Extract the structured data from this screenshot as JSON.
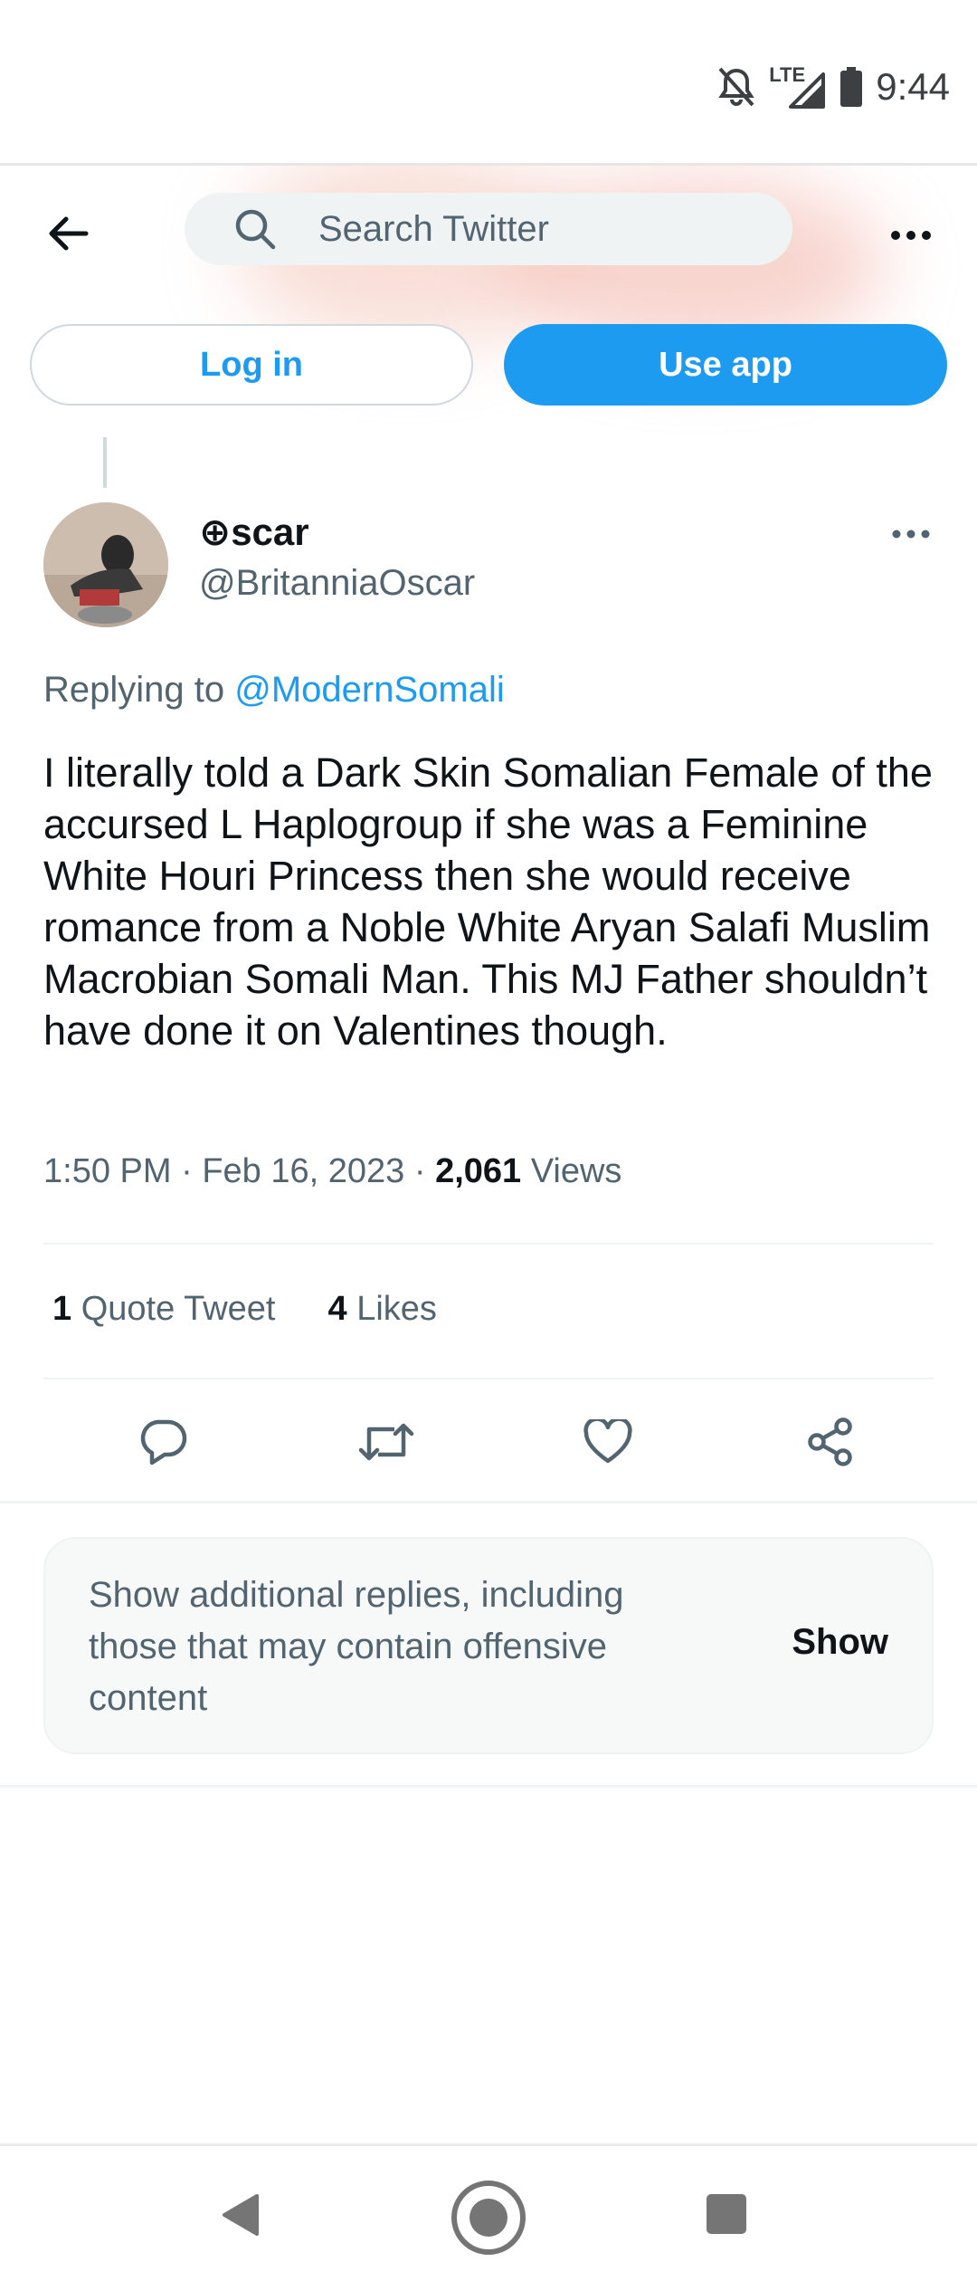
{
  "status_bar": {
    "time": "9:44",
    "network": "LTE",
    "icons": [
      "notifications-off-icon",
      "signal-icon",
      "battery-icon"
    ]
  },
  "header": {
    "search_placeholder": "Search Twitter",
    "back_icon": "arrow-left-icon",
    "more_icon": "more-horizontal-icon"
  },
  "auth": {
    "login_label": "Log in",
    "use_app_label": "Use app"
  },
  "tweet": {
    "display_name": "⊕scar",
    "handle": "@BritanniaOscar",
    "replying_prefix": "Replying to",
    "replying_to": "@ModernSomali",
    "text": "I literally told a Dark Skin Somalian Female of the accursed L Haplogroup if she was a Feminine White Houri Princess then she would receive romance from a Noble White Aryan Salafi Muslim Macrobian Somali Man. This MJ Father shouldn’t have done it on Valentines though.",
    "time": "1:50 PM",
    "separator": "·",
    "date": "Feb 16, 2023",
    "views_count": "2,061",
    "views_label": "Views",
    "quote_count": "1",
    "quote_label": "Quote Tweet",
    "likes_count": "4",
    "likes_label": "Likes"
  },
  "actions": {
    "icons": [
      "reply-icon",
      "retweet-icon",
      "like-icon",
      "share-icon"
    ]
  },
  "additional_replies": {
    "text": "Show additional replies, including those that may contain offensive content",
    "button_label": "Show"
  },
  "colors": {
    "accent": "#1d9bf0",
    "text_primary": "#0f1419",
    "text_secondary": "#536471",
    "divider": "#eff3f4"
  }
}
